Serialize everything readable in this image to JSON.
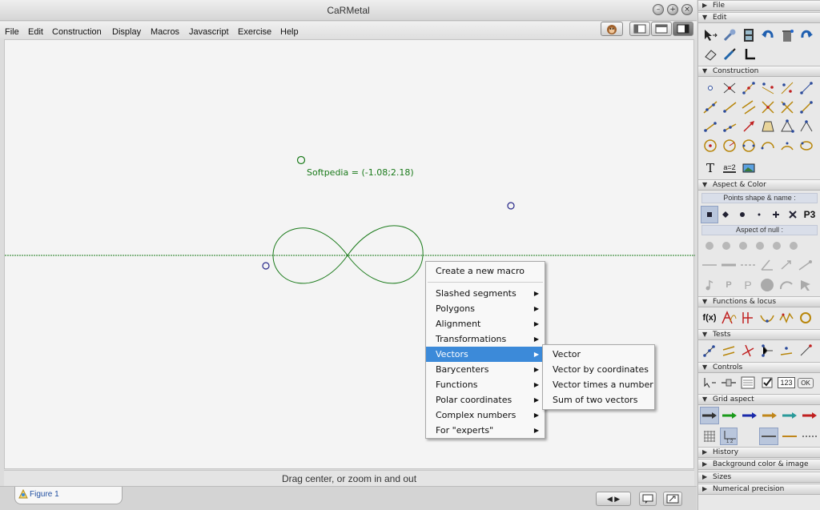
{
  "window": {
    "title": "CaRMetal"
  },
  "menubar": {
    "items": [
      "File",
      "Edit",
      "Construction",
      "Display",
      "Macros",
      "Javascript",
      "Exercise",
      "Help"
    ]
  },
  "canvas": {
    "point_label": "Softpedia = (-1.08;2.18)"
  },
  "context_menu": {
    "create_macro": "Create a new macro",
    "items": [
      "Slashed segments",
      "Polygons",
      "Alignment",
      "Transformations",
      "Vectors",
      "Barycenters",
      "Functions",
      "Polar coordinates",
      "Complex numbers",
      "For \"experts\""
    ],
    "selected": "Vectors"
  },
  "submenu": {
    "items": [
      "Vector",
      "Vector by coordinates",
      "Vector times a number",
      "Sum of two vectors"
    ]
  },
  "status": {
    "text": "Drag center, or zoom in and out"
  },
  "tab": {
    "label": "Figure 1"
  },
  "panel": {
    "sections": {
      "file": "File",
      "edit": "Edit",
      "construction": "Construction",
      "aspect": "Aspect & Color",
      "functions": "Functions & locus",
      "tests": "Tests",
      "controls": "Controls",
      "grid": "Grid aspect",
      "history": "History",
      "background": "Background color & image",
      "sizes": "Sizes",
      "precision": "Numerical precision"
    },
    "points_header": "Points shape & name :",
    "null_header": "Aspect of null :",
    "p3_label": "P3",
    "fx_label": "f(x)",
    "t_label": "T",
    "a2_label": "a=2",
    "num_label": "123",
    "ok_label": "OK"
  },
  "colors": {
    "curve": "#1a7a1a",
    "point_blue": "#2a2a8a",
    "selection": "#3c8ad9"
  }
}
